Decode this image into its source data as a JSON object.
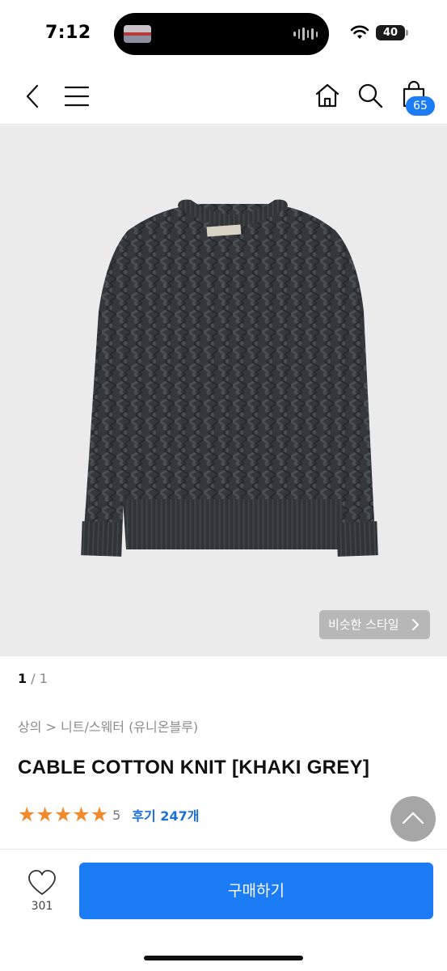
{
  "status_bar": {
    "time": "7:12",
    "battery": "40",
    "battery_level": 0.4
  },
  "header": {
    "back_icon": "chevron-left-icon",
    "menu_icon": "hamburger-menu-icon",
    "home_icon": "home-icon",
    "search_icon": "search-icon",
    "cart_icon": "shopping-bag-icon",
    "cart_count": "65"
  },
  "product": {
    "image_alt": "sweater-image",
    "similar_style_label": "비슷한 스타일",
    "pager_current": "1",
    "pager_total": "/ 1",
    "breadcrumb": "상의 > 니트/스웨터 (유니온블루)",
    "title": "CABLE COTTON KNIT [KHAKI GREY]",
    "rating_stars": 5,
    "rating_score": "5",
    "review_label": "후기 247개"
  },
  "bottom_bar": {
    "wishlist_count": "301",
    "buy_label": "구매하기"
  },
  "colors": {
    "accent": "#1b7cf5",
    "star": "#f08a2c",
    "link": "#1b6fd8"
  }
}
